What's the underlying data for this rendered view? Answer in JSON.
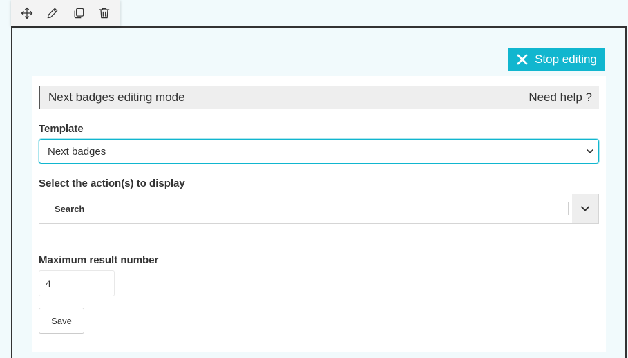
{
  "toolbar": {
    "icons": [
      "move-icon",
      "edit-icon",
      "duplicate-icon",
      "delete-icon"
    ]
  },
  "stop_editing": {
    "label": "Stop editing",
    "icon": "close-icon",
    "color": "#11b6cf"
  },
  "header": {
    "title": "Next badges editing mode",
    "help_link": "Need help ?"
  },
  "template": {
    "label": "Template",
    "selected": "Next badges"
  },
  "actions": {
    "label": "Select the action(s) to display",
    "selected": "Search"
  },
  "max_result": {
    "label": "Maximum result number",
    "value": "4"
  },
  "save": {
    "label": "Save"
  }
}
